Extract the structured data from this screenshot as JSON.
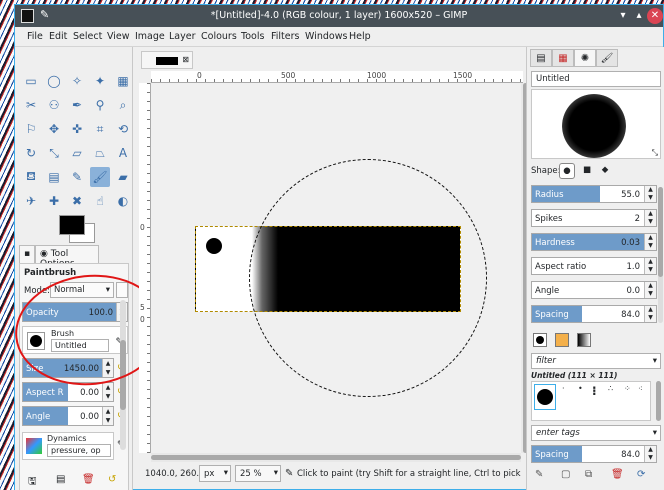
{
  "window": {
    "title": "*[Untitled]-4.0 (RGB colour, 1 layer) 1600x520 – GIMP",
    "controls": {
      "minimize": "▾",
      "maximize": "▴",
      "close": "✕"
    }
  },
  "menu": [
    "File",
    "Edit",
    "Select",
    "View",
    "Image",
    "Layer",
    "Colours",
    "Tools",
    "Filters",
    "Windows",
    "Help"
  ],
  "toolbox": {
    "tools": [
      {
        "name": "rect-select-icon",
        "glyph": "▭"
      },
      {
        "name": "ellipse-select-icon",
        "glyph": "◯"
      },
      {
        "name": "free-select-icon",
        "glyph": "✧"
      },
      {
        "name": "fuzzy-select-icon",
        "glyph": "✦"
      },
      {
        "name": "select-by-color-icon",
        "glyph": "▦"
      },
      {
        "name": "scissors-icon",
        "glyph": "✂"
      },
      {
        "name": "foreground-select-icon",
        "glyph": "⚇"
      },
      {
        "name": "paths-icon",
        "glyph": "✒"
      },
      {
        "name": "color-picker-icon",
        "glyph": "⚲"
      },
      {
        "name": "zoom-icon",
        "glyph": "⌕"
      },
      {
        "name": "measure-icon",
        "glyph": "⚐"
      },
      {
        "name": "move-icon",
        "glyph": "✥"
      },
      {
        "name": "align-icon",
        "glyph": "✜"
      },
      {
        "name": "crop-icon",
        "glyph": "⌗"
      },
      {
        "name": "unified-transform-icon",
        "glyph": "⟲"
      },
      {
        "name": "rotate-icon",
        "glyph": "↻"
      },
      {
        "name": "scale-icon",
        "glyph": "⤡"
      },
      {
        "name": "shear-icon",
        "glyph": "▱"
      },
      {
        "name": "perspective-icon",
        "glyph": "⏢"
      },
      {
        "name": "text-icon",
        "glyph": "A"
      },
      {
        "name": "bucket-fill-icon",
        "glyph": "⛾"
      },
      {
        "name": "gradient-icon",
        "glyph": "▤"
      },
      {
        "name": "pencil-icon",
        "glyph": "✎"
      },
      {
        "name": "paintbrush-icon",
        "glyph": "🖌"
      },
      {
        "name": "eraser-icon",
        "glyph": "▰"
      },
      {
        "name": "airbrush-icon",
        "glyph": "✈"
      },
      {
        "name": "clone-icon",
        "glyph": "✚"
      },
      {
        "name": "heal-icon",
        "glyph": "✖"
      },
      {
        "name": "smudge-icon",
        "glyph": "☝"
      },
      {
        "name": "dodge-burn-icon",
        "glyph": "◐"
      }
    ],
    "active_tool": "paintbrush-icon"
  },
  "tool_options": {
    "tabs": [
      "",
      "Tool Options"
    ],
    "title": "Paintbrush",
    "mode_label": "Mode:",
    "mode_value": "Normal",
    "opacity": {
      "label": "Opacity",
      "value": "100.0",
      "fraction": 1.0
    },
    "brush_label": "Brush",
    "brush_value": "Untitled",
    "size": {
      "label": "Size",
      "value": "1450.00",
      "fraction": 0.92
    },
    "aspect": {
      "label": "Aspect R",
      "value": "0.00",
      "fraction": 0.5
    },
    "angle": {
      "label": "Angle",
      "value": "0.00",
      "fraction": 0.5
    },
    "dynamics_label": "Dynamics",
    "dynamics_value": "pressure, op"
  },
  "image_tab": {
    "close": "⊠"
  },
  "rulers": {
    "top": [
      "0",
      "500",
      "1000",
      "1500"
    ],
    "left": [
      "0",
      "5",
      "0"
    ]
  },
  "status": {
    "coords": "1040.0, 260.0",
    "unit": "px",
    "zoom": "25 %",
    "message": "Click to paint (try Shift for a straight line, Ctrl to pick ..."
  },
  "dock": {
    "brush_name": "Untitled",
    "shape_label": "Shape:",
    "shapes": [
      "●",
      "■",
      "◆"
    ],
    "params": [
      {
        "label": "Radius",
        "value": "55.0",
        "fraction": 0.55
      },
      {
        "label": "Spikes",
        "value": "2",
        "fraction": 0.0
      },
      {
        "label": "Hardness",
        "value": "0.03",
        "fraction": 1.0
      },
      {
        "label": "Aspect ratio",
        "value": "1.0",
        "fraction": 0.0
      },
      {
        "label": "Angle",
        "value": "0.0",
        "fraction": 0.0
      },
      {
        "label": "Spacing",
        "value": "84.0",
        "fraction": 0.4
      }
    ],
    "filter_placeholder": "filter",
    "brush_list_label": "Untitled (111 × 111)",
    "tags_placeholder": "enter tags",
    "spacing": {
      "label": "Spacing",
      "value": "84.0",
      "fraction": 0.4
    }
  },
  "colors": {
    "accent": "#6e9bc9",
    "titlebar": "#475057",
    "annotation": "#e01616"
  }
}
